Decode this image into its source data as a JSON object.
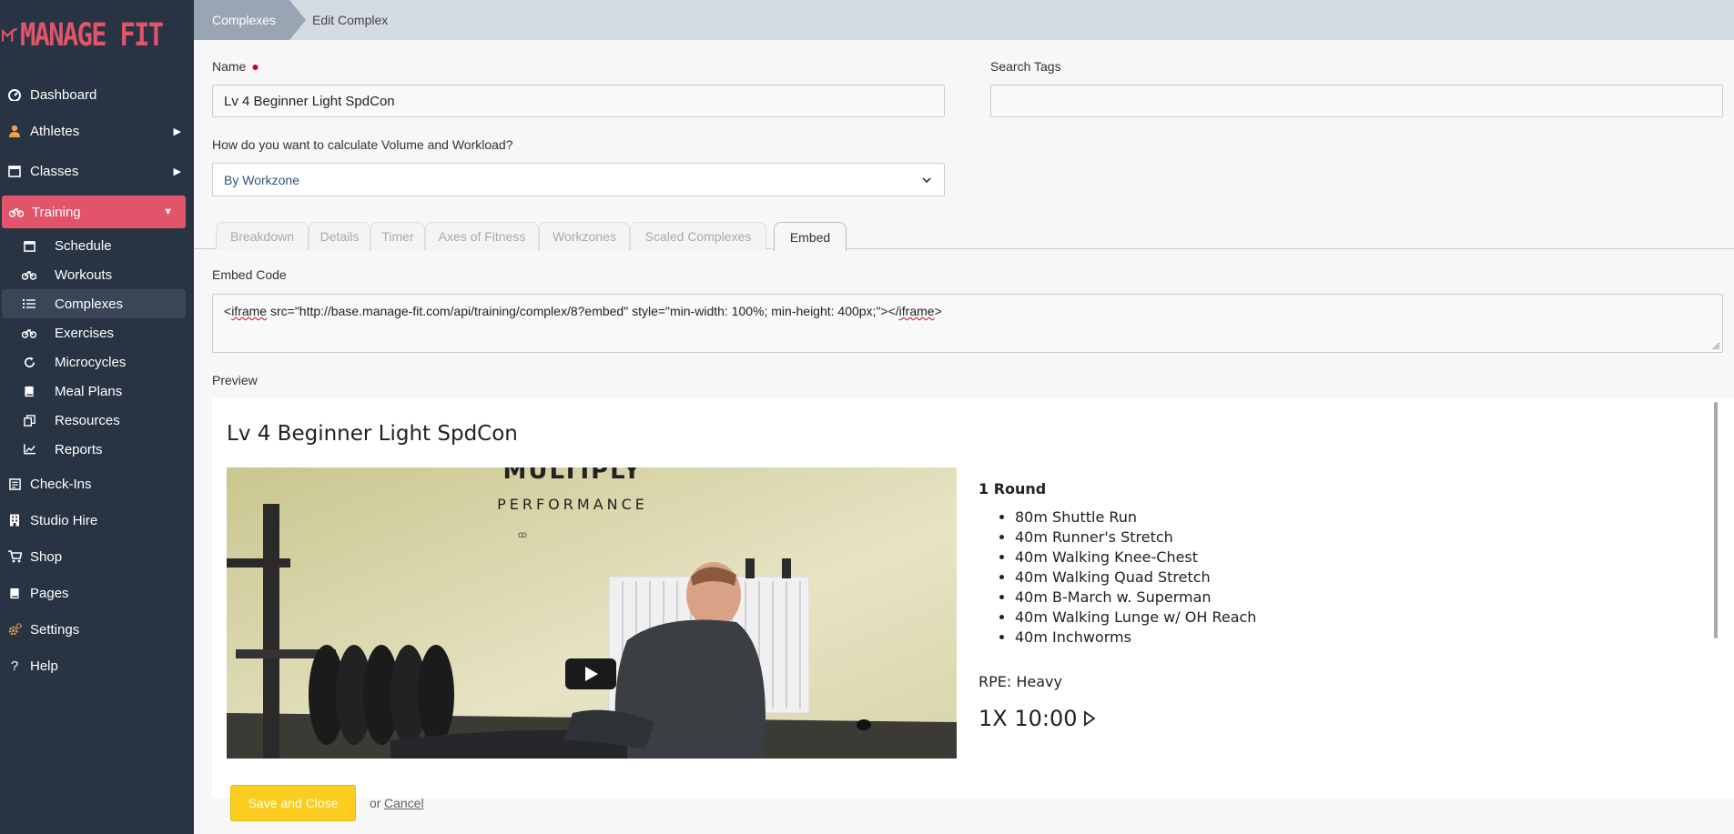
{
  "brand": {
    "logo_text": "MANAGE FIT",
    "accent": "#e2546a"
  },
  "sidebar": {
    "items": [
      {
        "label": "Dashboard",
        "icon": "dashboard-icon"
      },
      {
        "label": "Athletes",
        "icon": "user-icon",
        "has_arrow": true
      },
      {
        "label": "Classes",
        "icon": "calendar-icon",
        "has_arrow": true
      },
      {
        "label": "Training",
        "icon": "bicycle-icon",
        "active": true
      },
      {
        "label": "Check-Ins",
        "icon": "checkin-icon"
      },
      {
        "label": "Studio Hire",
        "icon": "building-icon"
      },
      {
        "label": "Shop",
        "icon": "cart-icon"
      },
      {
        "label": "Pages",
        "icon": "book-icon"
      },
      {
        "label": "Settings",
        "icon": "gear-icon"
      },
      {
        "label": "Help",
        "icon": "question-icon"
      }
    ],
    "training_sub": [
      {
        "label": "Schedule",
        "icon": "calendar-icon"
      },
      {
        "label": "Workouts",
        "icon": "bicycle-icon"
      },
      {
        "label": "Complexes",
        "icon": "list-icon",
        "selected": true
      },
      {
        "label": "Exercises",
        "icon": "bicycle-icon"
      },
      {
        "label": "Microcycles",
        "icon": "refresh-icon"
      },
      {
        "label": "Meal Plans",
        "icon": "book-icon"
      },
      {
        "label": "Resources",
        "icon": "copy-icon"
      },
      {
        "label": "Reports",
        "icon": "chart-icon"
      }
    ]
  },
  "breadcrumb": {
    "parent": "Complexes",
    "current": "Edit Complex"
  },
  "form": {
    "name_label": "Name",
    "name_value": "Lv 4 Beginner Light SpdCon",
    "tags_label": "Search Tags",
    "tags_value": "",
    "calc_label": "How do you want to calculate Volume and Workload?",
    "calc_value": "By Workzone"
  },
  "tabs": [
    "Breakdown",
    "Details",
    "Timer",
    "Axes of Fitness",
    "Workzones",
    "Scaled Complexes",
    "Embed"
  ],
  "embed": {
    "label": "Embed Code",
    "code_pre": "<",
    "code_word1": "iframe",
    "code_mid": " src=\"http://base.manage-fit.com/api/training/complex/8?embed\" style=\"min-width: 100%; min-height: 400px;\"></",
    "code_word2": "iframe",
    "code_post": ">"
  },
  "preview": {
    "label": "Preview",
    "title": "Lv 4 Beginner Light SpdCon",
    "video_wall_text_1": "MULTIPLY",
    "video_wall_text_2": "PERFORMANCE",
    "round_title": "1 Round",
    "exercises": [
      "80m Shuttle Run",
      "40m Runner's Stretch",
      "40m Walking Knee-Chest",
      "40m Walking Quad Stretch",
      "40m B-March w. Superman",
      "40m Walking Lunge w/ OH Reach",
      "40m Inchworms"
    ],
    "rpe": "RPE: Heavy",
    "timer": "1X 10:00"
  },
  "actions": {
    "save": "Save and Close",
    "or": "or",
    "cancel": "Cancel"
  }
}
